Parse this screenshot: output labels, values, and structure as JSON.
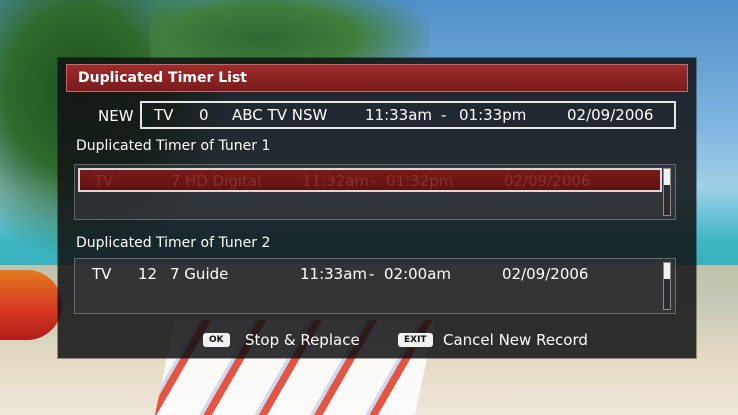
{
  "dialog": {
    "title": "Duplicated Timer List"
  },
  "new_entry": {
    "label": "NEW",
    "type": "TV",
    "channel": "0",
    "name": "ABC TV NSW",
    "start": "11:33am",
    "separator": "-",
    "end": "01:33pm",
    "date": "02/09/2006"
  },
  "tuner1": {
    "label": "Duplicated Timer of Tuner 1",
    "rows": [
      {
        "type": "TV",
        "channel": "7",
        "name": "HD Digital",
        "start": "11:32am",
        "separator": "-",
        "end": "01:32pm",
        "date": "02/09/2006",
        "selected": true
      }
    ]
  },
  "tuner2": {
    "label": "Duplicated Timer of Tuner 2",
    "rows": [
      {
        "type": "TV",
        "channel": "12",
        "name": "7 Guide",
        "start": "11:33am",
        "separator": "-",
        "end": "02:00am",
        "date": "02/09/2006",
        "selected": false
      }
    ]
  },
  "footer": {
    "ok_key": "OK",
    "ok_label": "Stop & Replace",
    "exit_key": "EXIT",
    "exit_label": "Cancel New Record"
  },
  "icons": {
    "ok": "ok-key-icon",
    "exit": "exit-key-icon"
  },
  "colors": {
    "title_bar": "#8b2323",
    "selected_row": "#6b1515",
    "panel_bg": "#121214"
  }
}
